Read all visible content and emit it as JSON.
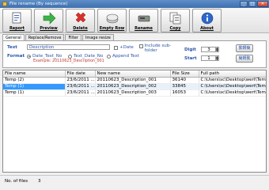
{
  "window": {
    "title": "File rename (By sequence)"
  },
  "toolbar": {
    "buttons": [
      {
        "label": "Report",
        "icon": "report-icon"
      },
      {
        "label": "Preview",
        "icon": "preview-arrow-icon"
      },
      {
        "label": "Delete",
        "icon": "delete-x-icon"
      },
      {
        "label": "Empty Row",
        "icon": "empty-row-icon"
      },
      {
        "label": "Rename",
        "icon": "rename-drive-icon"
      },
      {
        "label": "Copy",
        "icon": "copy-icon"
      },
      {
        "label": "About",
        "icon": "about-info-icon"
      }
    ]
  },
  "tabs": [
    "General",
    "Replace/Remove",
    "Filter",
    "Image resize"
  ],
  "general": {
    "text_label": "Text",
    "text_value": "Description",
    "date_checkbox": "+Date",
    "include_subfolder": "Include sub-folder",
    "format_label": "Format",
    "formats": [
      "Date_Text_No",
      "Text_Date_No",
      "Append Text"
    ],
    "example": "Example: 20110623_Description_001",
    "digit_label": "Digit",
    "digit_value": "3",
    "start_label": "Start",
    "start_value": "1",
    "side_button_1": "繁轉簡",
    "side_button_2": "簡轉繁"
  },
  "grid": {
    "columns": [
      "File name",
      "File date",
      "New name",
      "File Size",
      "Full path"
    ],
    "rows": [
      [
        "Temp (2)",
        "23/6/2011 ...",
        "20110623_Description_001",
        "36140",
        "C:\\Users\\sc\\Desktop\\wert\\Temp (2"
      ],
      [
        "Temp (1)",
        "23/6/2011 ...",
        "20110623_Description_002",
        "33845",
        "C:\\Users\\sc\\Desktop\\wert\\Temp (1"
      ],
      [
        "Temp (1)",
        "23/6/2011 ...",
        "20110623_Description_003",
        "16053",
        "C:\\Users\\sc\\Desktop\\wert\\Temp (1"
      ]
    ]
  },
  "status": {
    "files_label": "No. of files",
    "files_count": "3"
  },
  "colors": {
    "accent": "#2a55a8",
    "selection": "#3399ff",
    "example": "#c0392b"
  }
}
